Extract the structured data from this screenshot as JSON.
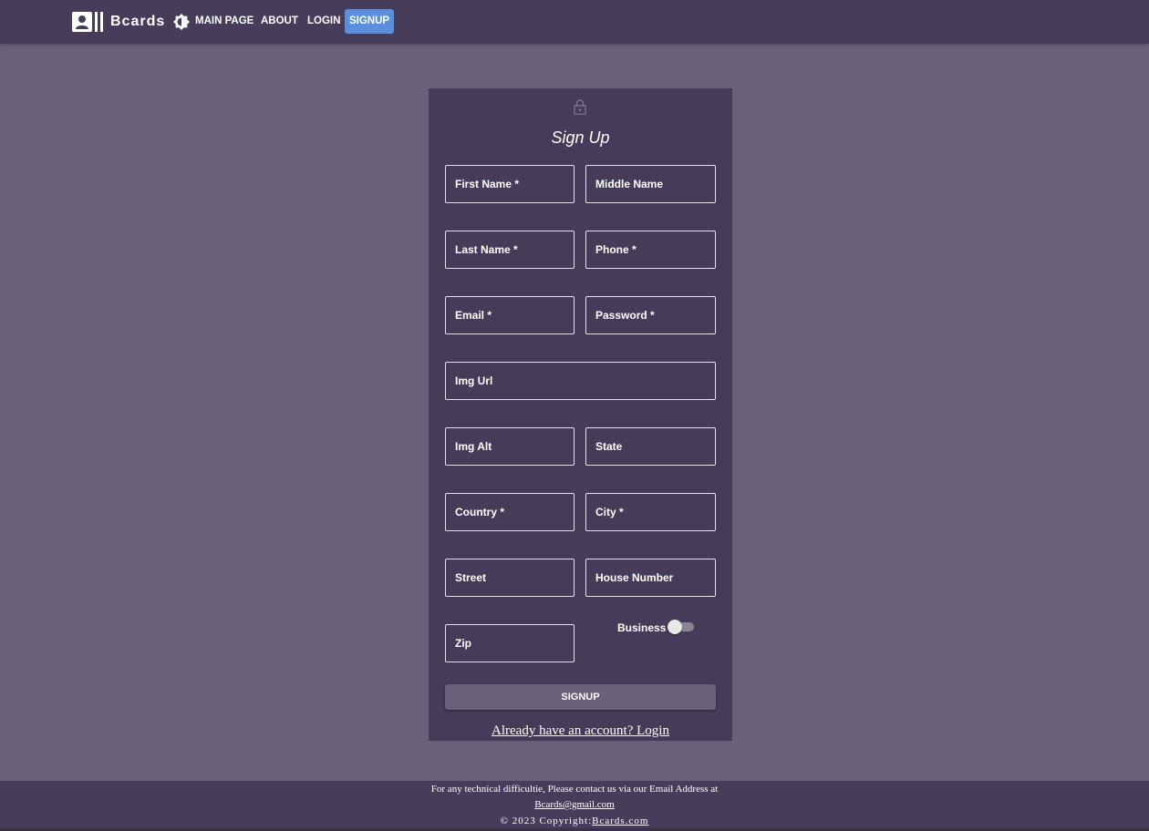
{
  "navbar": {
    "brand": "Bcards",
    "brand_icon": "contact-card-icon",
    "theme_icon": "brightness-icon",
    "links": [
      "MAIN PAGE",
      "ABOUT",
      "LOGIN",
      "SIGNUP"
    ],
    "active_link": "SIGNUP",
    "active_color": "#5a8fe0"
  },
  "form": {
    "icon": "lock-icon",
    "title": "Sign Up",
    "fields": {
      "first_name": "First Name *",
      "middle_name": "Middle Name",
      "last_name": "Last Name *",
      "phone": "Phone *",
      "email": "Email *",
      "password": "Password *",
      "img_url": "Img Url",
      "img_alt": "Img Alt",
      "state": "State",
      "country": "Country *",
      "city": "City *",
      "street": "Street",
      "house_number": "House Number",
      "zip": "Zip"
    },
    "business_label": "Business",
    "business_checked": false,
    "submit_label": "SIGNUP",
    "login_link": "Already have an account? Login"
  },
  "footer": {
    "line1": "For any technical difficultie, Please contact us via our Email Address at",
    "email": "Bcards@gmail.com",
    "copyright_prefix": "© 2023 Copyright:",
    "copyright_link": "Bcards.com"
  },
  "colors": {
    "page_bg": "#6a607a",
    "bar_bg": "#473d5b",
    "card_bg": "#463c59"
  }
}
